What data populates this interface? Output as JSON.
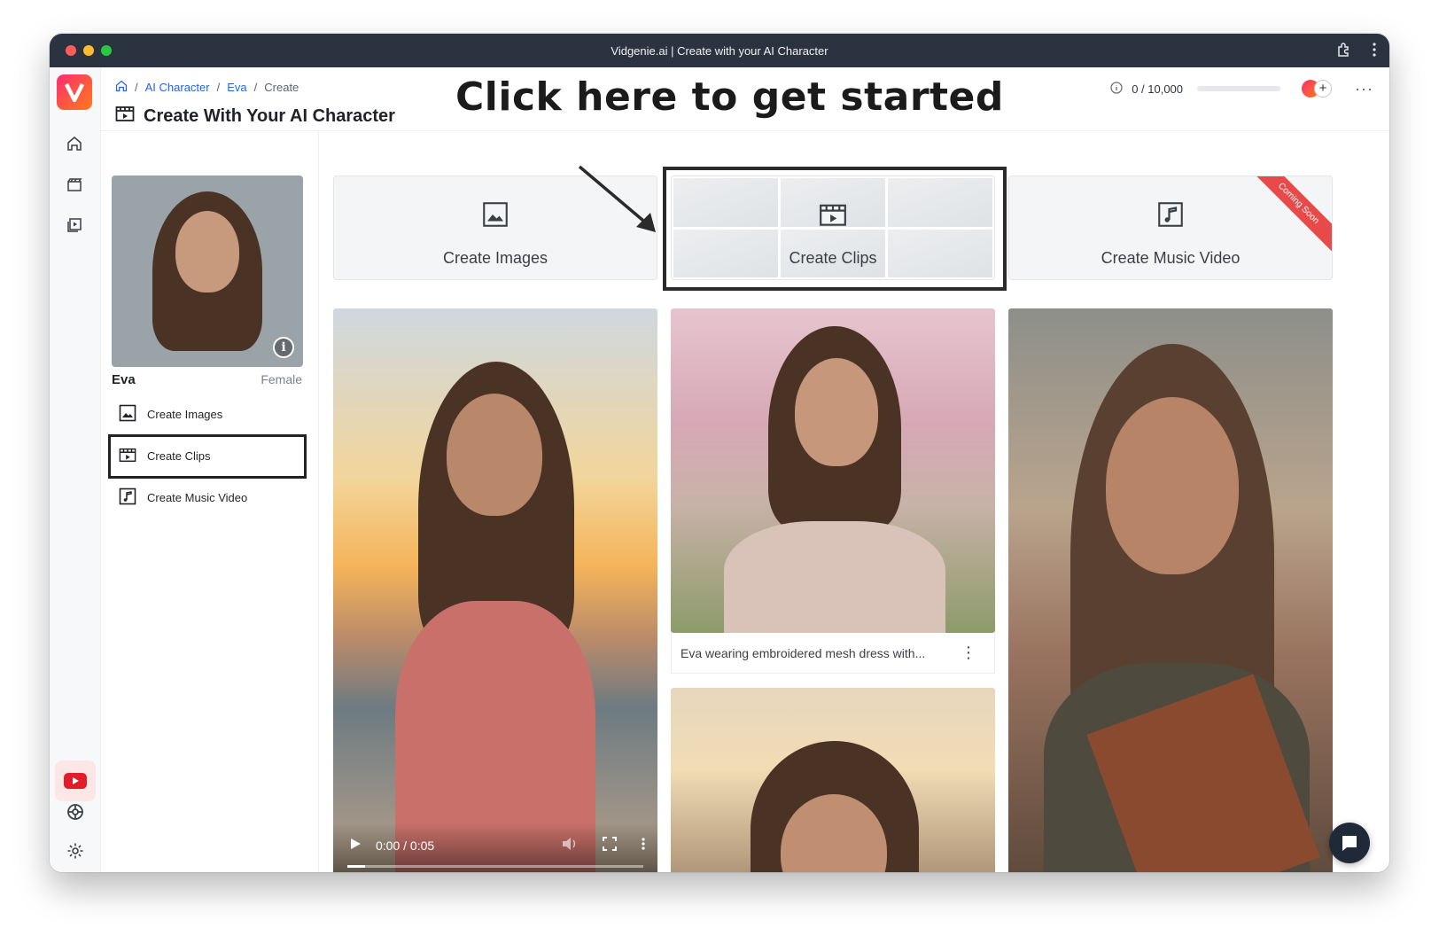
{
  "window": {
    "title": "Vidgenie.ai | Create with your AI Character"
  },
  "breadcrumb": {
    "sep": "/",
    "items": [
      "AI Character",
      "Eva",
      "Create"
    ]
  },
  "page": {
    "title": "Create With Your AI Character"
  },
  "annotation": {
    "text": "Click here to get started"
  },
  "credits": {
    "text": "0 / 10,000",
    "used_fraction": 0
  },
  "avatar_add": "+",
  "character": {
    "name": "Eva",
    "gender": "Female"
  },
  "side_menu": [
    "Create Images",
    "Create Clips",
    "Create Music Video"
  ],
  "cards": [
    {
      "label": "Create Images"
    },
    {
      "label": "Create Clips"
    },
    {
      "label": "Create Music Video",
      "badge": "Coming Soon"
    }
  ],
  "gallery": {
    "caption": "Eva wearing embroidered mesh dress with..."
  },
  "video": {
    "time": "0:00 / 0:05",
    "progress_fraction": 0.06
  },
  "colors": {
    "brand_start": "#ff2d6f",
    "brand_end": "#ff7a1a",
    "link": "#2563eb",
    "titlebar": "#2b3340"
  },
  "icons": [
    "home-icon",
    "clapperboard-icon",
    "video-library-icon",
    "youtube-icon",
    "support-icon",
    "settings-icon",
    "info-icon",
    "image-icon",
    "clips-icon",
    "music-note-icon",
    "chat-icon",
    "play-icon",
    "volume-icon",
    "fullscreen-icon"
  ]
}
